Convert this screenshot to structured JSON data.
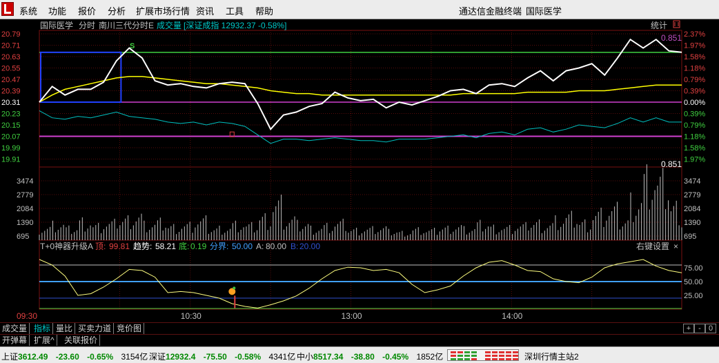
{
  "menu": {
    "items": [
      "系统",
      "功能",
      "报价",
      "分析",
      "扩展市场行情",
      "资讯",
      "工具",
      "帮助"
    ],
    "app_title": "通达信金融终端",
    "stock_name": "国际医学"
  },
  "chart_header": {
    "stock": "国际医学",
    "mode": "分时",
    "indicator": "南川三代分时E",
    "volume_label": "成交量",
    "index_label": "[深证成指 12932.37 -0.58%]",
    "stats_label": "统计",
    "stats_icon": "restore-icon",
    "ratio_value": "0.851",
    "vol_ratio_value": "0.851"
  },
  "price_axis": {
    "left": [
      "20.79",
      "20.71",
      "20.63",
      "20.55",
      "20.47",
      "20.39",
      "20.31",
      "20.23",
      "20.15",
      "20.07",
      "19.99",
      "19.91"
    ],
    "right": [
      "2.37%",
      "1.97%",
      "1.58%",
      "1.18%",
      "0.79%",
      "0.39%",
      "0.00%",
      "0.39%",
      "0.79%",
      "1.18%",
      "1.58%",
      "1.97%"
    ]
  },
  "volume_axis": [
    "3474",
    "2779",
    "2084",
    "1390",
    "695"
  ],
  "indicator_panel": {
    "name": "T+0神器升级A",
    "top_label": "顶:",
    "top_value": "99.81",
    "trend_label": "趋势:",
    "trend_value": "58.21",
    "bottom_label": "底:",
    "bottom_value": "0.19",
    "boundary_label": "分界:",
    "boundary_value": "50.00",
    "a_label": "A:",
    "a_value": "80.00",
    "b_label": "B:",
    "b_value": "20.00",
    "settings_label": "右键设置",
    "close_glyph": "×",
    "axis": [
      "75.00",
      "50.00",
      "25.00"
    ]
  },
  "time_axis": [
    "09:30",
    "10:30",
    "13:00",
    "14:00"
  ],
  "chart_data": {
    "type": "line",
    "price_y_range": [
      19.91,
      20.79
    ],
    "base_price": 20.31,
    "price_series_x": [
      0,
      0.02,
      0.04,
      0.06,
      0.08,
      0.1,
      0.12,
      0.14,
      0.16,
      0.18,
      0.2,
      0.22,
      0.24,
      0.26,
      0.28,
      0.3,
      0.32,
      0.34,
      0.36,
      0.38,
      0.4,
      0.42,
      0.44,
      0.46,
      0.48,
      0.5,
      0.52,
      0.54,
      0.56,
      0.58,
      0.6,
      0.62,
      0.64,
      0.66,
      0.68,
      0.7,
      0.72,
      0.74,
      0.76,
      0.78,
      0.8,
      0.82,
      0.84,
      0.86,
      0.88,
      0.9,
      0.92,
      0.94,
      0.96,
      0.98,
      1.0
    ],
    "price_values": [
      20.31,
      20.42,
      20.36,
      20.4,
      20.4,
      20.45,
      20.6,
      20.69,
      20.62,
      20.46,
      20.43,
      20.44,
      20.42,
      20.41,
      20.44,
      20.45,
      20.44,
      20.3,
      20.12,
      20.22,
      20.24,
      20.28,
      20.3,
      20.38,
      20.34,
      20.32,
      20.33,
      20.27,
      20.31,
      20.29,
      20.32,
      20.35,
      20.39,
      20.4,
      20.37,
      20.43,
      20.44,
      20.42,
      20.48,
      20.53,
      20.46,
      20.53,
      20.55,
      20.58,
      20.5,
      20.62,
      20.75,
      20.69,
      20.75,
      20.67,
      20.66
    ],
    "avg_values": [
      20.31,
      20.36,
      20.4,
      20.42,
      20.44,
      20.46,
      20.48,
      20.49,
      20.49,
      20.48,
      20.47,
      20.46,
      20.45,
      20.44,
      20.44,
      20.43,
      20.42,
      20.41,
      20.39,
      20.38,
      20.37,
      20.37,
      20.36,
      20.36,
      20.36,
      20.36,
      20.36,
      20.36,
      20.36,
      20.36,
      20.36,
      20.36,
      20.36,
      20.37,
      20.37,
      20.37,
      20.37,
      20.37,
      20.38,
      20.38,
      20.38,
      20.38,
      20.39,
      20.39,
      20.39,
      20.4,
      20.41,
      20.42,
      20.43,
      20.43,
      20.43
    ],
    "cyan_values": [
      20.25,
      20.2,
      20.19,
      20.21,
      20.2,
      20.22,
      20.24,
      20.21,
      20.2,
      20.19,
      20.17,
      20.16,
      20.17,
      20.15,
      20.17,
      20.16,
      20.14,
      20.08,
      20.02,
      20.05,
      20.05,
      20.04,
      20.05,
      20.06,
      20.05,
      20.04,
      20.04,
      20.03,
      20.05,
      20.05,
      20.05,
      20.06,
      20.07,
      20.08,
      20.06,
      20.09,
      20.1,
      20.08,
      20.12,
      20.13,
      20.1,
      20.12,
      20.15,
      20.14,
      20.13,
      20.16,
      20.2,
      20.17,
      20.2,
      20.17,
      20.17
    ],
    "volume_y_range": [
      0,
      4200
    ],
    "volume_values": [
      700,
      900,
      650,
      1100,
      800,
      950,
      1200,
      1400,
      900,
      1000,
      780,
      850,
      1100,
      650,
      700,
      900,
      800,
      1300,
      2100,
      1200,
      900,
      700,
      800,
      950,
      600,
      650,
      700,
      500,
      450,
      600,
      550,
      700,
      800,
      650,
      900,
      750,
      700,
      800,
      1000,
      900,
      1150,
      1300,
      1000,
      1500,
      1700,
      1100,
      2300,
      3500,
      3200,
      1900,
      1200
    ],
    "oscillator_y_range": [
      0,
      100
    ],
    "oscillator_values": [
      90,
      80,
      60,
      25,
      28,
      40,
      55,
      72,
      70,
      58,
      30,
      32,
      30,
      25,
      20,
      10,
      5,
      2,
      8,
      15,
      24,
      38,
      55,
      70,
      76,
      75,
      70,
      72,
      66,
      45,
      30,
      35,
      42,
      60,
      75,
      85,
      88,
      80,
      70,
      68,
      55,
      50,
      48,
      58,
      75,
      82,
      86,
      90,
      78,
      70,
      66
    ],
    "lines": {
      "top_green": 20.66,
      "magenta_low": 20.07,
      "boundary": 50,
      "a": 80,
      "b": 20
    },
    "colors": {
      "price": "#ffffff",
      "avg": "#ffff00",
      "cyan": "#00c0c0",
      "volume": "#c0c0c0",
      "oscillator": "#ffff80",
      "grid": "#7a0f0f"
    }
  },
  "tabs": {
    "row1": [
      "成交量",
      "指标",
      "量比",
      "买卖力道",
      "竞价图"
    ],
    "row1_active": 1,
    "row2": [
      "开弹幕",
      "扩展^",
      "关联报价"
    ],
    "plus": "+",
    "minus": "-",
    "zero": "0"
  },
  "statusbar": {
    "sh_label": "上证",
    "sh_value": "3612.49",
    "sh_change": "-23.60",
    "sh_pct": "-0.65%",
    "sh_amount": "3154亿",
    "sz_label": "深证",
    "sz_value": "12932.4",
    "sz_change": "-75.50",
    "sz_pct": "-0.58%",
    "sz_amount": "4341亿",
    "zx_label": "中小",
    "zx_value": "8517.34",
    "zx_change": "-38.80",
    "zx_pct": "-0.45%",
    "zx_amount": "1852亿",
    "server": "深圳行情主站2"
  }
}
